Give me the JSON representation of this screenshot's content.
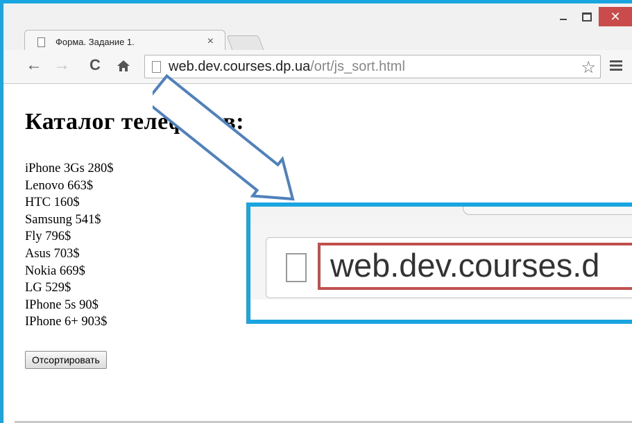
{
  "browser": {
    "tab": {
      "title": "Форма. Задание 1.",
      "close_glyph": "×"
    },
    "window_controls": {
      "close_glyph": "✕"
    },
    "toolbar": {
      "back_glyph": "←",
      "forward_glyph": "→",
      "reload_glyph": "C",
      "url_host": "web.dev.courses.dp.ua",
      "url_path": "/ort/js_sort.html",
      "star_glyph": "☆"
    }
  },
  "page": {
    "heading": "Каталог телефонов:",
    "phones": [
      "iPhone 3Gs 280$",
      "Lenovo 663$",
      "HTC 160$",
      "Samsung 541$",
      "Fly 796$",
      "Asus 703$",
      "Nokia 669$",
      "LG 529$",
      "IPhone 5s 90$",
      "IPhone 6+ 903$"
    ],
    "sort_button_label": "Отсортировать"
  },
  "zoom_callout": {
    "url_text": "web.dev.courses.d"
  },
  "colors": {
    "frame_blue": "#1aa4e0",
    "arrow_blue": "#4f81bd",
    "highlight_red": "#c0504d",
    "close_red": "#c94b4b"
  },
  "icons": [
    "page-icon",
    "back-arrow-icon",
    "forward-arrow-icon",
    "reload-icon",
    "home-icon",
    "star-icon",
    "menu-icon",
    "minimize-icon",
    "maximize-icon",
    "close-icon",
    "callout-arrow-icon"
  ]
}
